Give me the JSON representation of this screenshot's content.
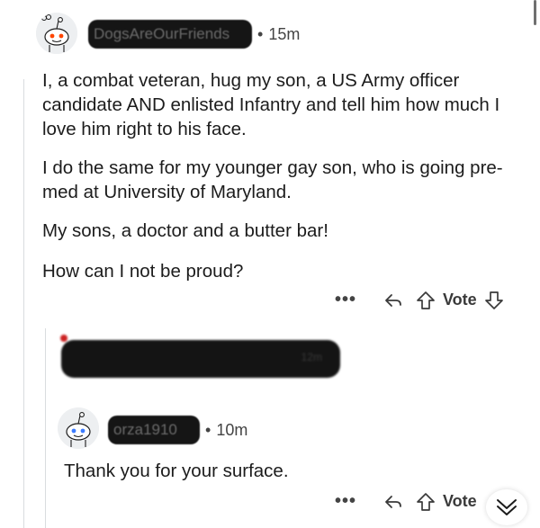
{
  "comment": {
    "author_redacted": "DogsAreOurFriends",
    "time": "15m",
    "paragraphs": [
      "I, a combat veteran, hug my son, a US Army officer candidate AND enlisted Infantry and tell him how much I love him right to his face.",
      "I do the same for my younger gay son, who is going pre-med at University of Maryland.",
      "My sons, a doctor and a butter bar!",
      "How can I not be proud?"
    ],
    "actions": {
      "more": "•••",
      "vote_label": "Vote"
    }
  },
  "redacted_reply": {
    "time_ghost": "12m"
  },
  "reply": {
    "author_redacted": "orza1910",
    "time": "10m",
    "text": "Thank you for your surface.",
    "actions": {
      "more": "•••",
      "vote_label": "Vote"
    }
  },
  "icons": [
    "snoo-avatar-icon",
    "reply-arrow-icon",
    "upvote-icon",
    "downvote-icon",
    "chevron-down-icon"
  ]
}
